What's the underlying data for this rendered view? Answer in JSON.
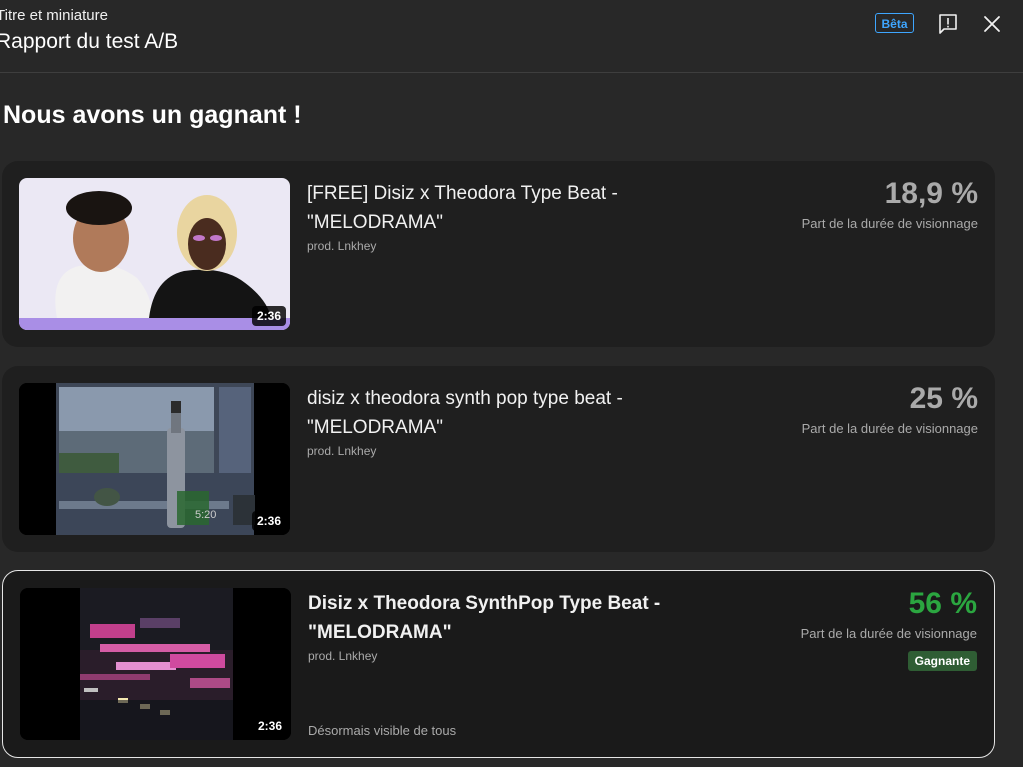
{
  "header": {
    "subtitle": "Titre et miniature",
    "title": "Rapport du test A/B",
    "beta_label": "Bêta"
  },
  "heading": "Nous avons un gagnant !",
  "variants": [
    {
      "title": "[FREE] Disiz x Theodora Type Beat - \"MELODRAMA\"",
      "producer": "prod. Lnkhey",
      "duration": "2:36",
      "percentage": "18,9 %",
      "metric": "Part de la durée de visionnage"
    },
    {
      "title": "disiz x theodora synth pop type beat - \"MELODRAMA\"",
      "producer": "prod. Lnkhey",
      "duration": "2:36",
      "percentage": "25 %",
      "metric": "Part de la durée de visionnage",
      "thumb_overlay": "5:20"
    },
    {
      "title": "Disiz x Theodora SynthPop Type Beat - \"MELODRAMA\"",
      "producer": "prod. Lnkhey",
      "duration": "2:36",
      "percentage": "56 %",
      "metric": "Part de la durée de visionnage",
      "badge": "Gagnante",
      "status": "Désormais visible de tous"
    }
  ],
  "icons": {
    "feedback": "feedback-icon",
    "close": "close-icon"
  },
  "colors": {
    "background": "#282828",
    "card": "#1f1f1f",
    "accent_blue": "#3ea6ff",
    "winner_green": "#2ba640",
    "muted_text": "#aaaaaa"
  }
}
